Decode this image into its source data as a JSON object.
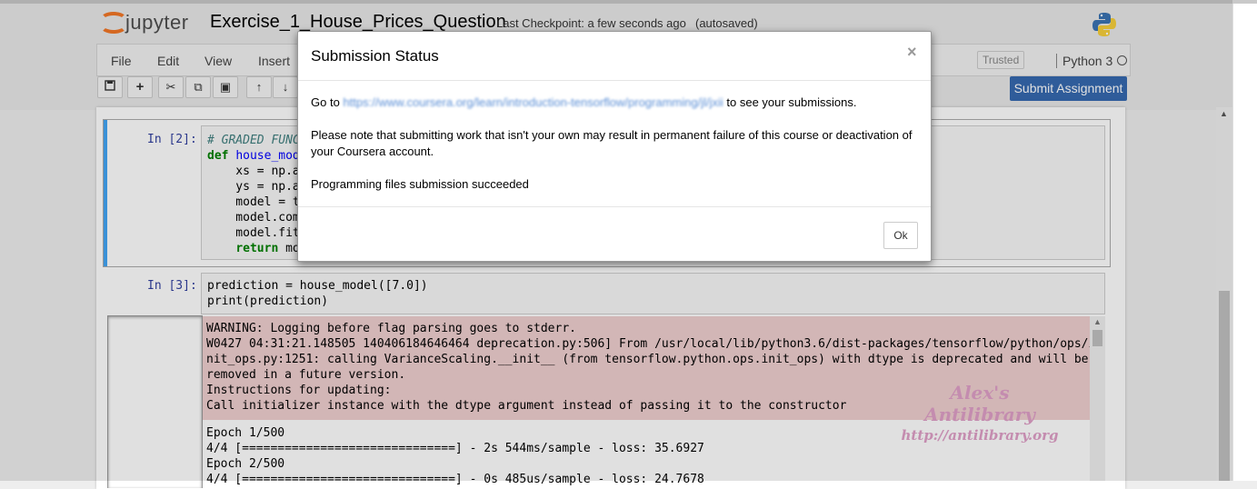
{
  "header": {
    "logo_text": "jupyter",
    "notebook_name": "Exercise_1_House_Prices_Question",
    "checkpoint": "Last Checkpoint: a few seconds ago",
    "autosave_status": "(autosaved)"
  },
  "menu": {
    "items": [
      "File",
      "Edit",
      "View",
      "Insert"
    ],
    "trusted": "Trusted",
    "kernel": "Python 3"
  },
  "toolbar": {
    "submit_label": "Submit Assignment",
    "submit_color": "#3669b0"
  },
  "cells": [
    {
      "prompt": "In [2]:",
      "code_lines": [
        "# GRADED FUNC",
        "def house_mod",
        "    xs = np.a",
        "    ys = np.a",
        "    model = t",
        "    model.com",
        "    model.fit",
        "    return mo"
      ]
    },
    {
      "prompt": "In [3]:",
      "code_lines": [
        "prediction = house_model([7.0])",
        "print(prediction)"
      ]
    }
  ],
  "output": {
    "stderr_lines": [
      "WARNING: Logging before flag parsing goes to stderr.",
      "W0427 04:31:21.148505 140406184646464 deprecation.py:506] From /usr/local/lib/python3.6/dist-packages/tensorflow/python/ops/i",
      "nit_ops.py:1251: calling VarianceScaling.__init__ (from tensorflow.python.ops.init_ops) with dtype is deprecated and will be",
      "removed in a future version.",
      "Instructions for updating:",
      "Call initializer instance with the dtype argument instead of passing it to the constructor"
    ],
    "stdout_lines": [
      "Epoch 1/500",
      "4/4 [==============================] - 2s 544ms/sample - loss: 35.6927",
      "Epoch 2/500",
      "4/4 [==============================] - 0s 485us/sample - loss: 24.7678"
    ],
    "stderr_color": "#f0d0d0"
  },
  "watermark": {
    "line1": "Alex's Antilibrary",
    "line2": "http://antilibrary.org"
  },
  "modal": {
    "title": "Submission Status",
    "close_symbol": "×",
    "goto_prefix": "Go to",
    "link_text": "https://www.coursera.org/learn/introduction-tensorflow/programming/jl/jxii",
    "goto_suffix": "to see your submissions.",
    "note": "Please note that submitting work that isn't your own may result in permanent failure of this course or deactivation of",
    "note_line2": "your Coursera account.",
    "status": "Programming files submission succeeded",
    "ok_label": "Ok"
  }
}
